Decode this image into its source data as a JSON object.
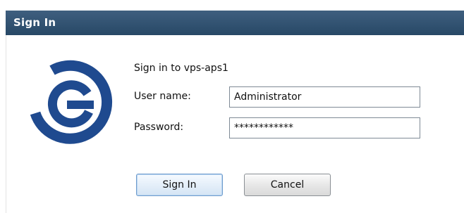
{
  "window": {
    "title": "Sign In"
  },
  "form": {
    "heading": "Sign in to vps-aps1",
    "username_label": "User name:",
    "username_value": "Administrator",
    "password_label": "Password:",
    "password_value": "************"
  },
  "buttons": {
    "sign_in_label": "Sign In",
    "cancel_label": "Cancel"
  },
  "colors": {
    "titlebar": "#2e4f70",
    "logo": "#1f4a8f"
  },
  "icons": {
    "logo": "circular-g-logo-icon"
  }
}
